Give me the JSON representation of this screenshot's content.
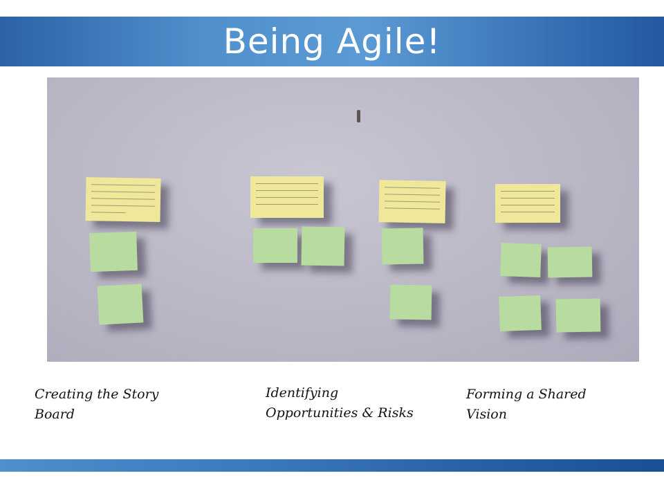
{
  "slide": {
    "title": "Being Agile!"
  },
  "captions": [
    "Creating the Story\nBoard",
    "Identifying\nOpportunities & Risks",
    "Forming a Shared\nVision"
  ],
  "colors": {
    "banner": "#3b76b8",
    "yellow_note": "#efe79a",
    "green_note": "#b8dba0",
    "wall": "#bdbac8"
  }
}
